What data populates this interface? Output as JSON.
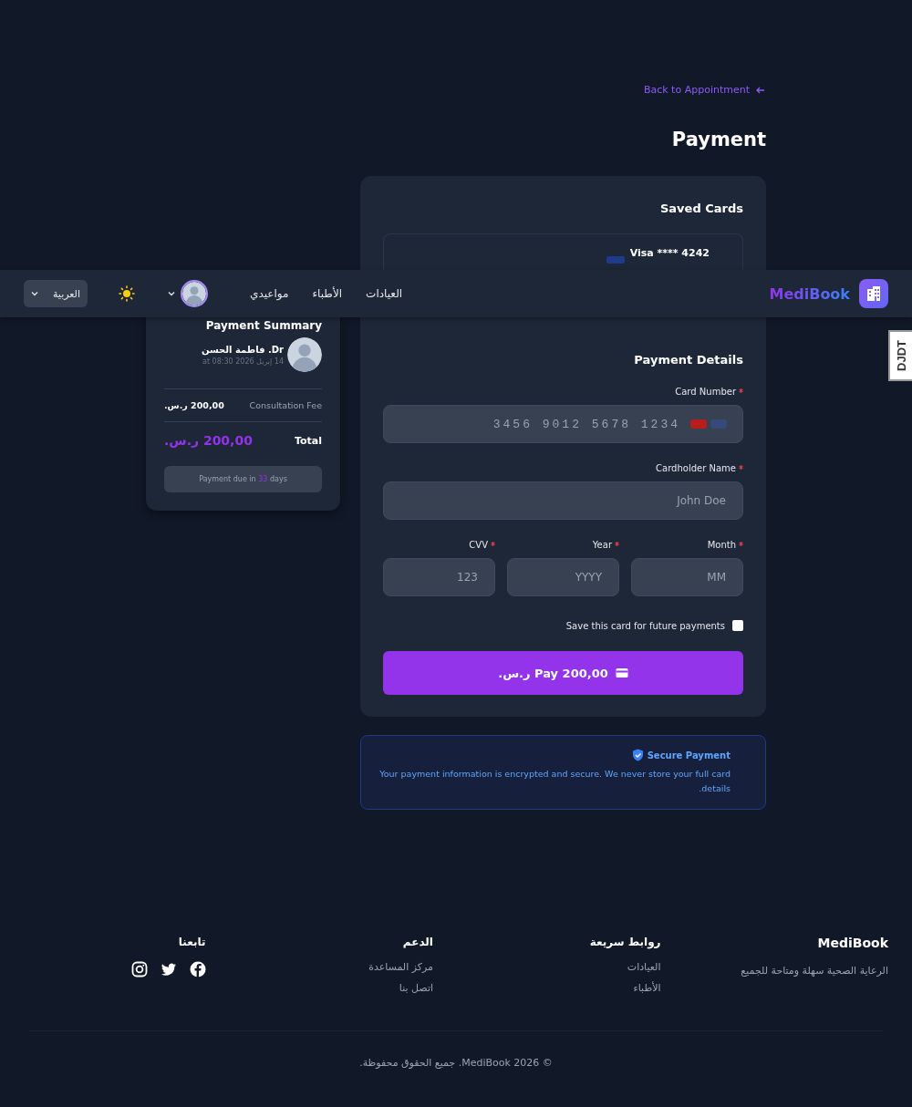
{
  "navbar": {
    "brand": "MediBook",
    "links": [
      {
        "label": "العيادات"
      },
      {
        "label": "الأطباء"
      },
      {
        "label": "مواعيدي"
      }
    ],
    "language": "العربية"
  },
  "debug_tab": "DJDT",
  "back_link": "Back to Appointment",
  "title": "Payment",
  "saved_cards": {
    "title": "Saved Cards",
    "cards": [
      {
        "label": "Visa **** 4242"
      }
    ]
  },
  "payment_details": {
    "title": "Payment Details",
    "card_number": {
      "label": "Card Number",
      "placeholder": "3456 9012 5678 1234",
      "required": true
    },
    "cardholder": {
      "label": "Cardholder Name",
      "placeholder": "John Doe",
      "required": true
    },
    "small_fields": [
      {
        "label": "Month",
        "placeholder": "MM",
        "required": true
      },
      {
        "label": "Year",
        "placeholder": "YYYY",
        "required": true
      },
      {
        "label": "CVV",
        "placeholder": "123",
        "required": true
      }
    ],
    "save_card": {
      "label": "Save this card for future payments",
      "checked": false
    },
    "pay_button": "Pay 200,00 ر.س."
  },
  "secure_note": {
    "title": "Secure Payment",
    "text": "Your payment information is encrypted and secure. We never store your full card details."
  },
  "summary": {
    "title": "Payment Summary",
    "doctor": "Dr. فاطمة الحسن",
    "date": "14 إبريل 2026 at 08:30",
    "fee_label": "Consultation Fee",
    "fee": "200,00 ر.س.",
    "total_label": "Total",
    "total": "200,00 ر.س.",
    "due": {
      "before": "Payment due in",
      "days": "33",
      "after": "days"
    }
  },
  "footer": {
    "brand": "MediBook",
    "tagline": "الرعاية الصحية سهلة ومتاحة للجميع",
    "columns": [
      {
        "title": "روابط سريعة",
        "links": [
          "العيادات",
          "الأطباء"
        ]
      },
      {
        "title": "الدعم",
        "links": [
          "مركز المساعدة",
          "اتصل بنا"
        ]
      }
    ],
    "social_title": "تابعنا",
    "copyright": "© 2026 MediBook. جميع الحقوق محفوظة."
  }
}
